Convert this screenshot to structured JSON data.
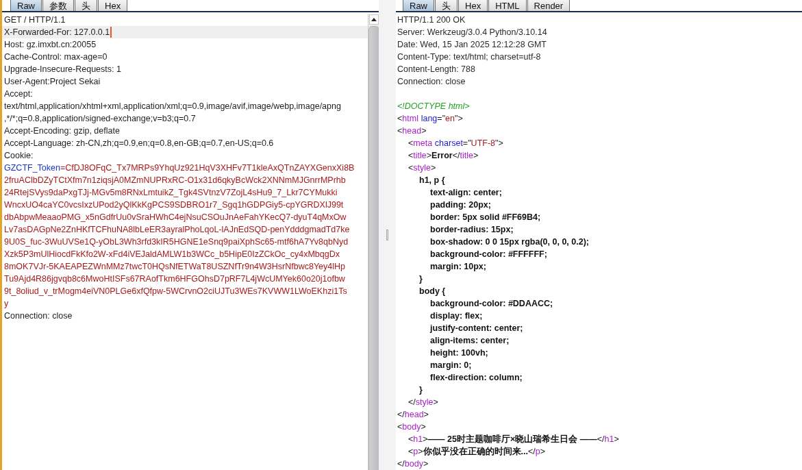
{
  "request": {
    "tabs": [
      {
        "label": "Raw",
        "selected": true
      },
      {
        "label": "参数",
        "selected": false
      },
      {
        "label": "头",
        "selected": false
      },
      {
        "label": "Hex",
        "selected": false
      }
    ],
    "lines": [
      {
        "kind": "plain",
        "text": "GET / HTTP/1.1",
        "current": false
      },
      {
        "kind": "plain",
        "text": "X-Forwarded-For: 127.0.0.1",
        "current": true
      },
      {
        "kind": "plain",
        "text": "Host: gz.imxbt.cn:20055",
        "current": false
      },
      {
        "kind": "plain",
        "text": "Cache-Control: max-age=0",
        "current": false
      },
      {
        "kind": "plain",
        "text": "Upgrade-Insecure-Requests: 1",
        "current": false
      },
      {
        "kind": "plain",
        "text": "User-Agent:Project Sekai",
        "current": false
      },
      {
        "kind": "plain",
        "text": "Accept:",
        "current": false
      },
      {
        "kind": "plain",
        "text": "text/html,application/xhtml+xml,application/xml;q=0.9,image/avif,image/webp,image/apng",
        "current": false
      },
      {
        "kind": "plain",
        "text": ",*/*;q=0.8,application/signed-exchange;v=b3;q=0.7",
        "current": false
      },
      {
        "kind": "plain",
        "text": "Accept-Encoding: gzip, deflate",
        "current": false
      },
      {
        "kind": "plain",
        "text": "Accept-Language: zh-CN,zh;q=0.9,en;q=0.8,en-GB;q=0.7,en-US;q=0.6",
        "current": false
      },
      {
        "kind": "plain",
        "text": "Cookie:",
        "current": false
      },
      {
        "kind": "cookie",
        "name": "GZCTF_Token",
        "separator": "=",
        "current": false,
        "value_lines": [
          "CfDJ8OFqC_Tx7MRPs9YhqUz921HqV3XHFv7T1kleAxQTnZAYXGenxXi8B",
          "2fruAClbDZyTCtXfm7n1ziqsjA0MZmNUPRxRC-O1x31d6qkyBcWck2XNNmMJGnrrMPrhb",
          "24RtejSVys9daPxgTJj-MGv5m8RNxLmtuikZ_Tgk4SVtnzV7ZojL4sHu9_7_Lkr7CYMukki",
          "WncxUO4caYC0vcsIxzUPod2yQlKkKgPCS9SDBRO1r7_Sgq1hGDPGiy5-cpYGRDXlJ99t",
          "dbAbpwMeaaoPMG_x5nGdfrUu0vSraHWhC4ejNsuCSOuJnAeFahYKecQ7-dyuT4qMxOw",
          "Lv7asDAGpNe2ZnHKfTCFhuNA8lbLeER3ayralPhoLqoL-lAJnEdSQD-penYdddgmadTd7ke",
          "9U0S_fuc-3WuUVSe1Q-yObL3Wh3rfd3kIR5HGNE1eSnq9paiXphSc65-mtf6hA7Yv8qbNyd",
          "Xzk5P3mUlHiocdFkKfo2W-xFd4iVEJaldAMLW1b3WCc_b5HipE0IzZCkOc_cy4xMbqgDx",
          "8mOK7VJr-5KAEAPEZWnMMz7twcT0HQsNfETWaT8USZNfTr9n4W3HsrNfbwc8Yey4lHp",
          "Tu9Ajd4R86jgvqb8c6MwoHtISFs67RAofTkm6HFGOhsD7pRF7L4jWcUMYek60o20j1ofbw",
          "9t_8oliud_v_trMogm4eiVN0PLGe6xfQfpw-5WCrvnO2ciUJTu3WEs7KVWW1LWoEKhzi1Ts",
          "y"
        ]
      },
      {
        "kind": "plain",
        "text": "Connection: close",
        "current": false
      }
    ]
  },
  "response": {
    "tabs": [
      {
        "label": "Raw",
        "selected": true
      },
      {
        "label": "头",
        "selected": false
      },
      {
        "label": "Hex",
        "selected": false
      },
      {
        "label": "HTML",
        "selected": false
      },
      {
        "label": "Render",
        "selected": false
      }
    ],
    "header_lines": [
      "HTTP/1.1 200 OK",
      "Server: Werkzeug/3.0.4 Python/3.10.14",
      "Date: Wed, 15 Jan 2025 12:12:28 GMT",
      "Content-Type: text/html; charset=utf-8",
      "Content-Length: 788",
      "Connection: close"
    ],
    "body": [
      {
        "parts": [
          {
            "kind": "doctype",
            "text": "<!DOCTYPE html>"
          }
        ]
      },
      {
        "parts": [
          {
            "kind": "punct",
            "text": "<"
          },
          {
            "kind": "tag",
            "text": "html"
          },
          {
            "kind": "attr",
            "text": "lang"
          },
          {
            "kind": "punct",
            "text": "=\""
          },
          {
            "kind": "value",
            "text": "en"
          },
          {
            "kind": "punct",
            "text": "\">"
          }
        ]
      },
      {
        "parts": [
          {
            "kind": "punct",
            "text": "<"
          },
          {
            "kind": "tag",
            "text": "head"
          },
          {
            "kind": "punct",
            "text": ">"
          }
        ],
        "children": [
          {
            "parts": [
              {
                "kind": "punct",
                "text": "<"
              },
              {
                "kind": "tag",
                "text": "meta"
              },
              {
                "kind": "attr",
                "text": "charset"
              },
              {
                "kind": "punct",
                "text": "=\""
              },
              {
                "kind": "value",
                "text": "UTF-8"
              },
              {
                "kind": "punct",
                "text": "\">"
              }
            ]
          },
          {
            "parts": [
              {
                "kind": "punct",
                "text": "<"
              },
              {
                "kind": "tag",
                "text": "title"
              },
              {
                "kind": "punct",
                "text": ">"
              },
              {
                "kind": "text",
                "text": "Error"
              },
              {
                "kind": "punct",
                "text": "</"
              },
              {
                "kind": "tag",
                "text": "title"
              },
              {
                "kind": "punct",
                "text": ">"
              }
            ]
          },
          {
            "parts": [
              {
                "kind": "punct",
                "text": "<"
              },
              {
                "kind": "tag",
                "text": "style"
              },
              {
                "kind": "punct",
                "text": ">"
              }
            ],
            "children": [
              {
                "parts": [
                  {
                    "kind": "css",
                    "text": "h1, p {"
                  }
                ],
                "children": [
                  {
                    "parts": [
                      {
                        "kind": "css",
                        "text": "text-align: center;"
                      }
                    ]
                  },
                  {
                    "parts": [
                      {
                        "kind": "css",
                        "text": "padding: 20px;"
                      }
                    ]
                  },
                  {
                    "parts": [
                      {
                        "kind": "css",
                        "text": "border: 5px solid #FF69B4;"
                      }
                    ]
                  },
                  {
                    "parts": [
                      {
                        "kind": "css",
                        "text": "border-radius: 15px;"
                      }
                    ]
                  },
                  {
                    "parts": [
                      {
                        "kind": "css",
                        "text": "box-shadow: 0 0 15px rgba(0, 0, 0, 0.2);"
                      }
                    ]
                  },
                  {
                    "parts": [
                      {
                        "kind": "css",
                        "text": "background-color: #FFFFFF;"
                      }
                    ]
                  },
                  {
                    "parts": [
                      {
                        "kind": "css",
                        "text": "margin: 10px;"
                      }
                    ]
                  }
                ]
              },
              {
                "parts": [
                  {
                    "kind": "css",
                    "text": "}"
                  }
                ]
              },
              {
                "parts": [
                  {
                    "kind": "css",
                    "text": "body {"
                  }
                ],
                "children": [
                  {
                    "parts": [
                      {
                        "kind": "css",
                        "text": "background-color: #DDAACC;"
                      }
                    ]
                  },
                  {
                    "parts": [
                      {
                        "kind": "css",
                        "text": "display: flex;"
                      }
                    ]
                  },
                  {
                    "parts": [
                      {
                        "kind": "css",
                        "text": "justify-content: center;"
                      }
                    ]
                  },
                  {
                    "parts": [
                      {
                        "kind": "css",
                        "text": "align-items: center;"
                      }
                    ]
                  },
                  {
                    "parts": [
                      {
                        "kind": "css",
                        "text": "height: 100vh;"
                      }
                    ]
                  },
                  {
                    "parts": [
                      {
                        "kind": "css",
                        "text": "margin: 0;"
                      }
                    ]
                  },
                  {
                    "parts": [
                      {
                        "kind": "css",
                        "text": "flex-direction: column;"
                      }
                    ]
                  }
                ]
              },
              {
                "parts": [
                  {
                    "kind": "css",
                    "text": "}"
                  }
                ]
              }
            ]
          },
          {
            "parts": [
              {
                "kind": "punct",
                "text": "</"
              },
              {
                "kind": "tag",
                "text": "style"
              },
              {
                "kind": "punct",
                "text": ">"
              }
            ]
          }
        ]
      },
      {
        "parts": [
          {
            "kind": "punct",
            "text": "</"
          },
          {
            "kind": "tag",
            "text": "head"
          },
          {
            "kind": "punct",
            "text": ">"
          }
        ]
      },
      {
        "parts": [
          {
            "kind": "punct",
            "text": "<"
          },
          {
            "kind": "tag",
            "text": "body"
          },
          {
            "kind": "punct",
            "text": ">"
          }
        ],
        "children": [
          {
            "parts": [
              {
                "kind": "punct",
                "text": "<"
              },
              {
                "kind": "tag",
                "text": "h1"
              },
              {
                "kind": "punct",
                "text": ">"
              },
              {
                "kind": "text",
                "text": "—— 25时主题咖啡厅×晓山瑞希生日会 ——"
              },
              {
                "kind": "punct",
                "text": "</"
              },
              {
                "kind": "tag",
                "text": "h1"
              },
              {
                "kind": "punct",
                "text": ">"
              }
            ]
          },
          {
            "parts": [
              {
                "kind": "punct",
                "text": "<"
              },
              {
                "kind": "tag",
                "text": "p"
              },
              {
                "kind": "punct",
                "text": ">"
              },
              {
                "kind": "text",
                "text": "你似乎没在正确的时间来..."
              },
              {
                "kind": "punct",
                "text": "</"
              },
              {
                "kind": "tag",
                "text": "p"
              },
              {
                "kind": "punct",
                "text": ">"
              }
            ]
          }
        ]
      },
      {
        "parts": [
          {
            "kind": "punct",
            "text": "</"
          },
          {
            "kind": "tag",
            "text": "body"
          },
          {
            "kind": "punct",
            "text": ">"
          }
        ]
      }
    ]
  }
}
